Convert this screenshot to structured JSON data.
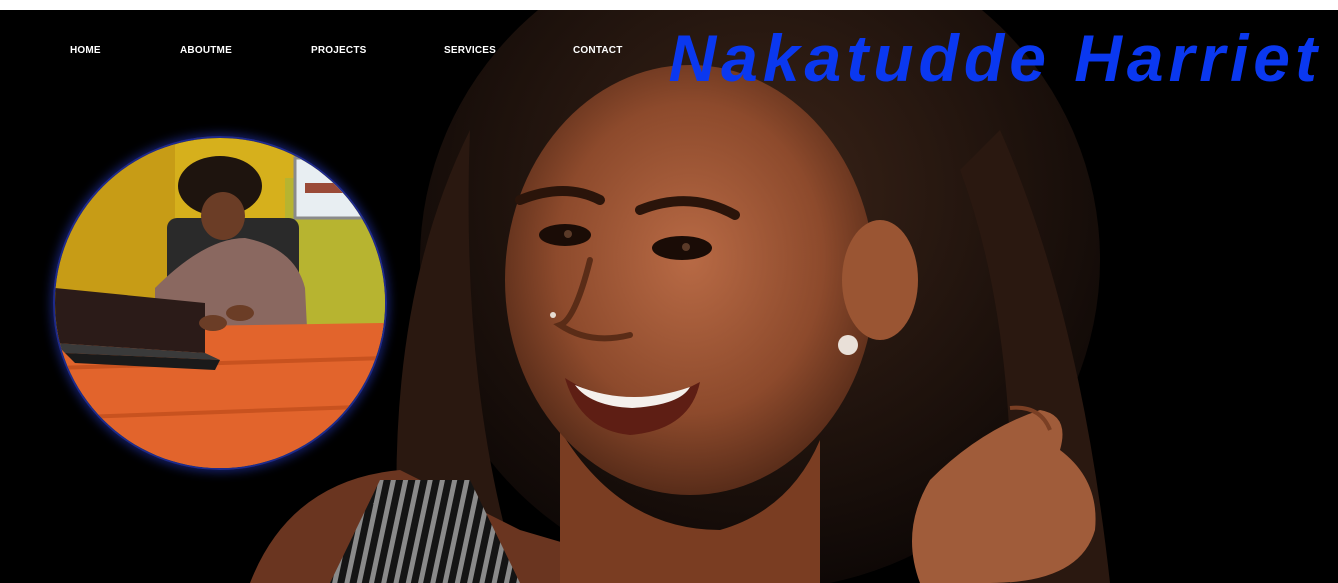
{
  "nav": {
    "items": [
      {
        "label": "HOME"
      },
      {
        "label": "ABOUTME"
      },
      {
        "label": "PROJECTS"
      },
      {
        "label": "SERVICES"
      },
      {
        "label": "CONTACT"
      }
    ]
  },
  "header": {
    "title": "Nakatudde Harriet"
  },
  "colors": {
    "title": "#0a38f0",
    "background": "#000000",
    "nav_text": "#ffffff",
    "avatar_ring": "#1f2a8a"
  }
}
